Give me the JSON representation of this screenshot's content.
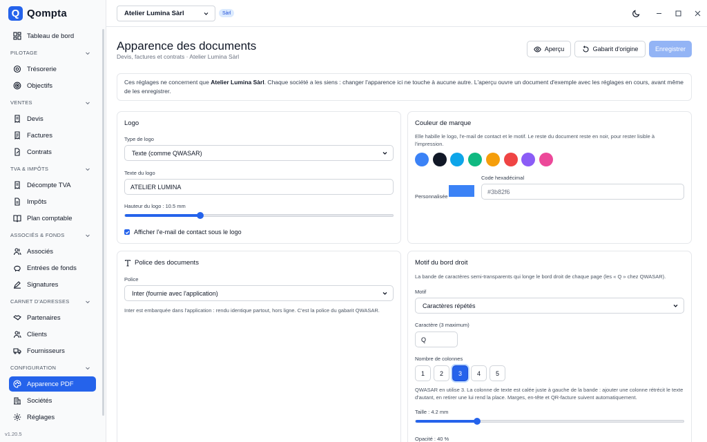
{
  "app": {
    "name": "Qompta",
    "logo_letter": "Q",
    "version": "v1.20.5"
  },
  "topbar": {
    "company": "Atelier Lumina Sàrl",
    "company_badge": "Sàrl"
  },
  "sidebar": {
    "top_item": {
      "label": "Tableau de bord",
      "icon": "dashboard-icon"
    },
    "sections": [
      {
        "title": "PILOTAGE",
        "items": [
          {
            "label": "Trésorerie",
            "icon": "treasury-icon"
          },
          {
            "label": "Objectifs",
            "icon": "target-icon"
          }
        ]
      },
      {
        "title": "VENTES",
        "items": [
          {
            "label": "Devis",
            "icon": "quote-icon"
          },
          {
            "label": "Factures",
            "icon": "invoice-icon"
          },
          {
            "label": "Contrats",
            "icon": "contract-icon"
          }
        ]
      },
      {
        "title": "TVA & IMPÔTS",
        "items": [
          {
            "label": "Décompte TVA",
            "icon": "vat-icon"
          },
          {
            "label": "Impôts",
            "icon": "tax-icon"
          },
          {
            "label": "Plan comptable",
            "icon": "book-icon"
          }
        ]
      },
      {
        "title": "ASSOCIÉS & FONDS",
        "items": [
          {
            "label": "Associés",
            "icon": "partners-icon"
          },
          {
            "label": "Entrées de fonds",
            "icon": "piggy-bank-icon"
          },
          {
            "label": "Signatures",
            "icon": "signature-icon"
          }
        ]
      },
      {
        "title": "CARNET D'ADRESSES",
        "items": [
          {
            "label": "Partenaires",
            "icon": "handshake-icon"
          },
          {
            "label": "Clients",
            "icon": "users-icon"
          },
          {
            "label": "Fournisseurs",
            "icon": "truck-icon"
          }
        ]
      },
      {
        "title": "CONFIGURATION",
        "items": [
          {
            "label": "Apparence PDF",
            "icon": "palette-icon",
            "active": true
          },
          {
            "label": "Sociétés",
            "icon": "building-icon"
          },
          {
            "label": "Réglages",
            "icon": "gear-icon"
          }
        ]
      }
    ]
  },
  "page": {
    "title": "Apparence des documents",
    "subtitle": "Devis, factures et contrats · Atelier Lumina Sàrl",
    "buttons": {
      "preview": "Aperçu",
      "reset": "Gabarit d'origine",
      "save": "Enregistrer"
    },
    "info_pre": "Ces réglages ne concernent que ",
    "info_bold": "Atelier Lumina Sàrl",
    "info_post": ". Chaque société a les siens : changer l'apparence ici ne touche à aucune autre. L'aperçu ouvre un document d'exemple avec les réglages en cours, avant même de les enregistrer."
  },
  "logo_card": {
    "title": "Logo",
    "type_label": "Type de logo",
    "type_value": "Texte (comme QWASAR)",
    "text_label": "Texte du logo",
    "text_value": "ATELIER LUMINA",
    "height_label": "Hauteur du logo : 10.5 mm",
    "height_fraction": 0.28,
    "show_email_label": "Afficher l'e-mail de contact sous le logo",
    "show_email_checked": true
  },
  "color_card": {
    "title": "Couleur de marque",
    "hint": "Elle habille le logo, l'e-mail de contact et le motif. Le reste du document reste en noir, pour rester lisible à l'impression.",
    "swatches": [
      "#3b82f6",
      "#111827",
      "#0ea5e9",
      "#10b981",
      "#f59e0b",
      "#ef4444",
      "#8b5cf6",
      "#ec4899"
    ],
    "custom_label": "Personnalisée",
    "custom_color": "#3b82f6",
    "hex_label": "Code hexadécimal",
    "hex_placeholder": "#3b82f6"
  },
  "font_card": {
    "title": "Police des documents",
    "font_label": "Police",
    "font_value": "Inter (fournie avec l'application)",
    "hint": "Inter est embarquée dans l'application : rendu identique partout, hors ligne. C'est la police du gabarit QWASAR."
  },
  "motif_card": {
    "title": "Motif du bord droit",
    "hint": "La bande de caractères semi-transparents qui longe le bord droit de chaque page (les « Q » chez QWASAR).",
    "motif_label": "Motif",
    "motif_value": "Caractères répétés",
    "char_label": "Caractère (3 maximum)",
    "char_value": "Q",
    "columns_label": "Nombre de colonnes",
    "columns": [
      "1",
      "2",
      "3",
      "4",
      "5"
    ],
    "columns_selected": "3",
    "columns_hint": "QWASAR en utilise 3. La colonne de texte est calée juste à gauche de la bande : ajouter une colonne rétrécit le texte d'autant, en retirer une lui rend la place. Marges, en-tête et QR-facture suivent automatiquement.",
    "size_label": "Taille : 4.2 mm",
    "size_fraction": 0.23,
    "opacity_label": "Opacité : 40 %"
  }
}
